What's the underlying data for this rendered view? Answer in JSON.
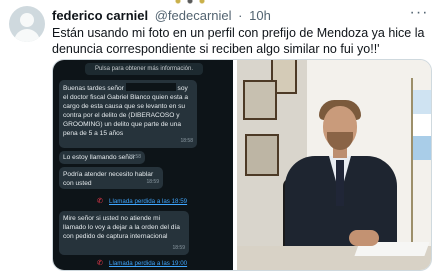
{
  "tweet": {
    "author_name": "federico carniel",
    "handle": "@fedecarniel",
    "separator": "·",
    "time": "10h",
    "more_icon": "more-horizontal-icon",
    "text": "Están usando mi foto en un perfil con prefijo de Mendoza ya hice la denuncia correspondiente si reciben algo similar no fui yo!!'"
  },
  "chat": {
    "system_message": "Pulsa para obtener más información.",
    "messages": [
      {
        "text_before": "Buenas tardes señor",
        "text_after": "soy el doctor fiscal Gabriel Blanco quien esta a cargo de esta causa que se levanto en su contra por el delito de (DIBERACOSO y GROOMING) un delito que parte de una pena de 5 a 15 años",
        "time": "18:58"
      },
      {
        "text": "Lo estoy llamando señor",
        "time": "18:58"
      },
      {
        "text": "Podría atender necesito hablar con usted",
        "time": "18:59"
      },
      {
        "text": "Mire señor si usted no atiende mi llamado lo voy a dejar a la orden del día con pedido de captura internacional",
        "time": "18:59"
      }
    ],
    "missed_calls": [
      {
        "icon": "missed-call-icon",
        "text": "Llamada perdida a las 18:59"
      },
      {
        "icon": "missed-call-icon",
        "text": "Llamada perdida a las 19:00"
      }
    ]
  }
}
